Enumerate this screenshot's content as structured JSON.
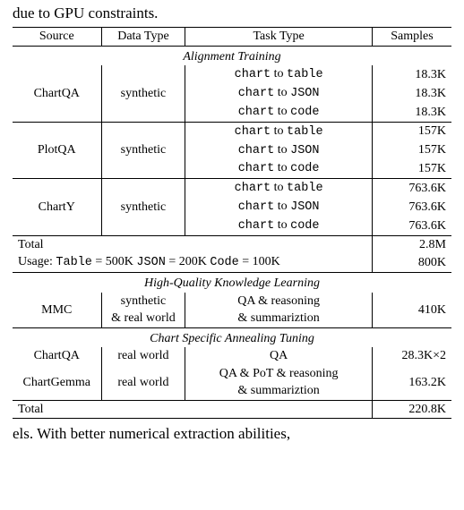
{
  "lead_text": "due to GPU constraints.",
  "trail_text": "els. With better numerical extraction abilities,",
  "headers": {
    "source": "Source",
    "dtype": "Data Type",
    "task": "Task Type",
    "samples": "Samples"
  },
  "sec1": {
    "title": "Alignment Training",
    "rows": [
      {
        "source": "ChartQA",
        "dtype": "synthetic",
        "tasks": [
          "chart to table",
          "chart to JSON",
          "chart to code"
        ],
        "samples": [
          "18.3K",
          "18.3K",
          "18.3K"
        ]
      },
      {
        "source": "PlotQA",
        "dtype": "synthetic",
        "tasks": [
          "chart to table",
          "chart to JSON",
          "chart to code"
        ],
        "samples": [
          "157K",
          "157K",
          "157K"
        ]
      },
      {
        "source": "ChartY",
        "dtype": "synthetic",
        "tasks": [
          "chart to table",
          "chart to JSON",
          "chart to code"
        ],
        "samples": [
          "763.6K",
          "763.6K",
          "763.6K"
        ]
      }
    ],
    "total_label": "Total",
    "total_value": "2.8M",
    "usage_prefix": "Usage: ",
    "usage_parts": {
      "t_key": "Table",
      "t_eq": " = 500K ",
      "j_key": "JSON",
      "j_eq": " = 200K ",
      "c_key": "Code",
      "c_eq": " = 100K"
    },
    "usage_value": "800K"
  },
  "sec2": {
    "title": "High-Quality Knowledge Learning",
    "row": {
      "source": "MMC",
      "dtype_l1": "synthetic",
      "dtype_l2": "& real world",
      "task_l1": "QA & reasoning",
      "task_l2": "& summariztion",
      "samples": "410K"
    }
  },
  "sec3": {
    "title": "Chart Specific Annealing Tuning",
    "rows": [
      {
        "source": "ChartQA",
        "dtype": "real world",
        "task_l1": "QA",
        "task_l2": "",
        "samples": "28.3K×2"
      },
      {
        "source": "ChartGemma",
        "dtype": "real world",
        "task_l1": "QA & PoT & reasoning",
        "task_l2": "& summariztion",
        "samples": "163.2K"
      }
    ],
    "total_label": "Total",
    "total_value": "220.8K"
  },
  "tok": {
    "chart": "chart",
    "to": " to ",
    "table": "table",
    "json": "JSON",
    "code": "code"
  }
}
